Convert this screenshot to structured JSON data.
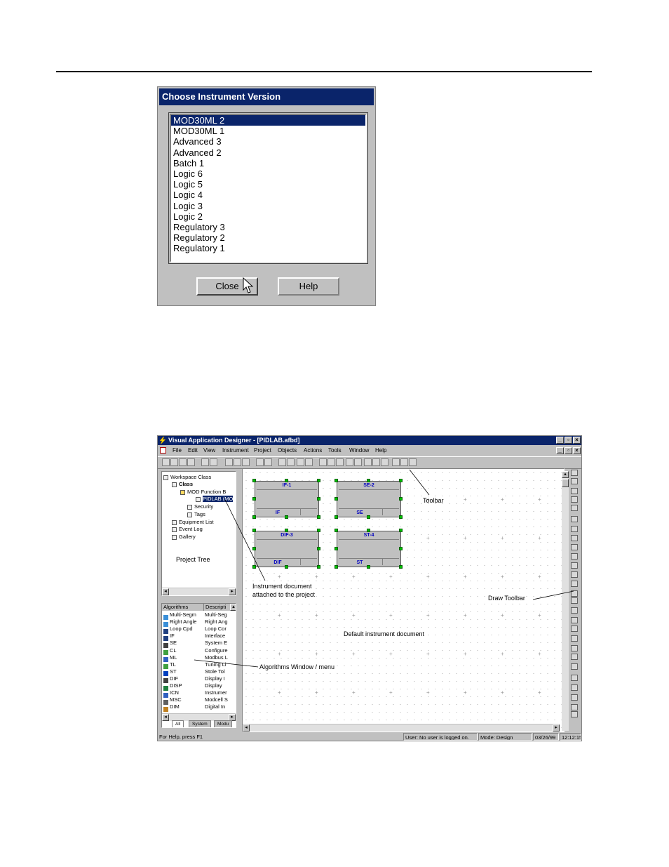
{
  "dialog": {
    "title": "Choose Instrument Version",
    "items": [
      "MOD30ML 2",
      "MOD30ML 1",
      "Advanced 3",
      "Advanced 2",
      "Batch 1",
      "Logic 6",
      "Logic 5",
      "Logic 4",
      "Logic 3",
      "Logic 2",
      "Regulatory 3",
      "Regulatory 2",
      "Regulatory 1"
    ],
    "selected_item": "MOD30ML 2",
    "close_label": "Close",
    "help_label": "Help"
  },
  "app": {
    "title": "Visual Application Designer - [PIDLAB.afbd]",
    "menu": [
      "File",
      "Edit",
      "View",
      "Instrument",
      "Project",
      "Objects",
      "Actions",
      "Tools",
      "Window",
      "Help"
    ],
    "tree": [
      {
        "label": "Workspace Class"
      },
      {
        "label": "Class"
      },
      {
        "label": "MOD Function B"
      },
      {
        "label": "PIDLAB (MO"
      },
      {
        "label": "Security"
      },
      {
        "label": "Tags"
      },
      {
        "label": "Equipment List"
      },
      {
        "label": "Event Log"
      },
      {
        "label": "Gallery"
      }
    ],
    "tree_caption": "Project Tree",
    "algorithms": {
      "headers": [
        "Algorithms",
        "Descripti"
      ],
      "rows": [
        {
          "name": "Multi-Segm",
          "desc": "Multi-Seg"
        },
        {
          "name": "Right Angle",
          "desc": "Right Ang"
        },
        {
          "name": "Loop Cpd",
          "desc": "Loop Cor"
        },
        {
          "name": "IF",
          "desc": "Interface"
        },
        {
          "name": "SE",
          "desc": "System E"
        },
        {
          "name": "CL",
          "desc": "Configure"
        },
        {
          "name": "ML",
          "desc": "Modbus L"
        },
        {
          "name": "TL",
          "desc": "Tuning Li"
        },
        {
          "name": "ST",
          "desc": "Stole Tol"
        },
        {
          "name": "DIF",
          "desc": "Display I"
        },
        {
          "name": "DISP",
          "desc": "Display"
        },
        {
          "name": "ICN",
          "desc": "Instrumer"
        },
        {
          "name": "MSC",
          "desc": "Modcell S"
        },
        {
          "name": "DIM",
          "desc": "Digital In"
        }
      ],
      "tabs": [
        "All",
        "System",
        "Modu"
      ]
    },
    "blocks": [
      {
        "name": "IF-1",
        "type": "IF"
      },
      {
        "name": "SE-2",
        "type": "SE"
      },
      {
        "name": "DIF-3",
        "type": "DIF"
      },
      {
        "name": "ST-4",
        "type": "ST"
      }
    ],
    "status": {
      "help": "For Help, press F1",
      "user": "User:  No user is logged on.",
      "mode": "Mode:  Design",
      "date": "03/26/99",
      "time": "12:12:15"
    }
  },
  "annotations": {
    "toolbar": "Toolbar",
    "instrument_doc_line1": "Instrument document",
    "instrument_doc_line2": "attached to the project",
    "draw_toolbar": "Draw Toolbar",
    "default_doc": "Default instrument document",
    "algorithms_window": "Algorithms Window / menu"
  },
  "colors": {
    "titlebar": "#0a246a",
    "selection": "#0a246a",
    "block_label": "#0000c0",
    "handle": "#00c000"
  }
}
